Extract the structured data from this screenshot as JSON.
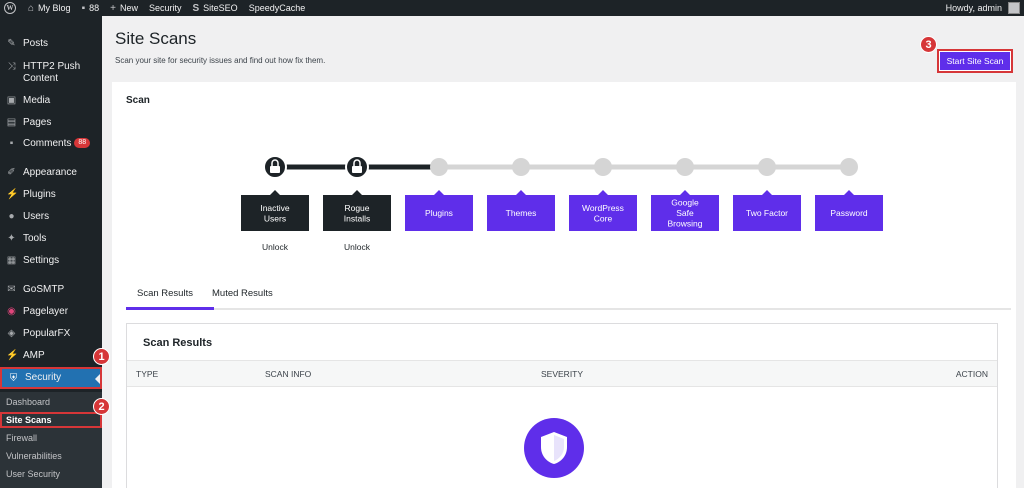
{
  "adminbar": {
    "site_name": "My Blog",
    "comments_count": "88",
    "new_label": "New",
    "security_label": "Security",
    "siteseo_label": "SiteSEO",
    "speedycache_label": "SpeedyCache",
    "howdy": "Howdy, admin"
  },
  "sidebar": {
    "items": [
      {
        "label": "Posts",
        "icon": "pin-icon"
      },
      {
        "label": "HTTP2 Push Content",
        "icon": "shuffle-icon"
      },
      {
        "label": "Media",
        "icon": "media-icon"
      },
      {
        "label": "Pages",
        "icon": "page-icon"
      },
      {
        "label": "Comments",
        "icon": "comment-icon",
        "badge": "88"
      },
      {
        "label": "Appearance",
        "icon": "brush-icon"
      },
      {
        "label": "Plugins",
        "icon": "plug-icon"
      },
      {
        "label": "Users",
        "icon": "user-icon"
      },
      {
        "label": "Tools",
        "icon": "wrench-icon"
      },
      {
        "label": "Settings",
        "icon": "settings-icon"
      },
      {
        "label": "GoSMTP",
        "icon": "gosmtp-icon"
      },
      {
        "label": "Pagelayer",
        "icon": "pagelayer-icon"
      },
      {
        "label": "PopularFX",
        "icon": "popularfx-icon"
      },
      {
        "label": "AMP",
        "icon": "amp-icon"
      },
      {
        "label": "Security",
        "icon": "shield-icon"
      }
    ],
    "submenu": [
      "Dashboard",
      "Site Scans",
      "Firewall",
      "Vulnerabilities",
      "User Security"
    ],
    "markers": [
      "1",
      "2",
      "3"
    ]
  },
  "page": {
    "title": "Site Scans",
    "description": "Scan your site for security issues and find out how fix them.",
    "start_button": "Start Site Scan",
    "card_title": "Scan"
  },
  "steps": [
    {
      "label": "Inactive\nUsers",
      "state": "locked",
      "sub": "Unlock"
    },
    {
      "label": "Rogue\nInstalls",
      "state": "locked",
      "sub": "Unlock"
    },
    {
      "label": "Plugins",
      "state": "open"
    },
    {
      "label": "Themes",
      "state": "open"
    },
    {
      "label": "WordPress\nCore",
      "state": "open"
    },
    {
      "label": "Google\nSafe\nBrowsing",
      "state": "open"
    },
    {
      "label": "Two Factor",
      "state": "open"
    },
    {
      "label": "Password",
      "state": "open"
    }
  ],
  "tabs": {
    "active": "Scan Results",
    "muted": "Muted Results"
  },
  "results": {
    "title": "Scan Results",
    "columns": {
      "type": "TYPE",
      "scan_info": "SCAN INFO",
      "severity": "SEVERITY",
      "action": "ACTION"
    }
  },
  "colors": {
    "accent": "#5f2eea",
    "dark_step": "#1d2327",
    "highlight": "#d63638",
    "wp_blue": "#2271b1"
  }
}
